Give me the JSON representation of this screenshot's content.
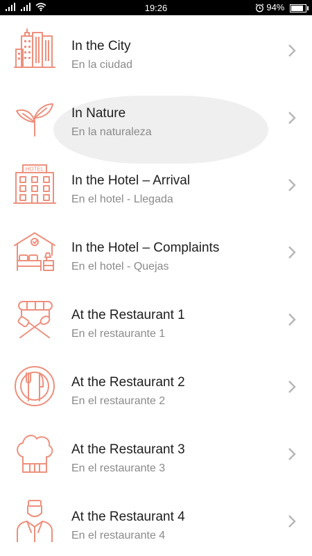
{
  "status_bar": {
    "time": "19:26",
    "battery": "94%",
    "battery_level": 0.94
  },
  "theme": {
    "icon_color": "#ee8f7c",
    "title_color": "#1d1d1d",
    "subtitle_color": "#8a8a8a"
  },
  "items": [
    {
      "title": "In the City",
      "subtitle": "En la ciudad",
      "icon": "city-buildings-icon"
    },
    {
      "title": "In Nature",
      "subtitle": "En la naturaleza",
      "icon": "sprout-icon"
    },
    {
      "title": "In the Hotel – Arrival",
      "subtitle": "En el hotel - Llegada",
      "icon": "hotel-building-icon",
      "icon_text": "HOTEL"
    },
    {
      "title": "In the Hotel – Complaints",
      "subtitle": "En el hotel - Quejas",
      "icon": "hotel-room-bed-icon"
    },
    {
      "title": "At the Restaurant 1",
      "subtitle": "En el restaurante 1",
      "icon": "grill-utensils-icon"
    },
    {
      "title": "At the Restaurant 2",
      "subtitle": "En el restaurante 2",
      "icon": "plate-fork-knife-icon"
    },
    {
      "title": "At the Restaurant 3",
      "subtitle": "En el restaurante 3",
      "icon": "chef-hat-icon"
    },
    {
      "title": "At the Restaurant 4",
      "subtitle": "En el restaurante 4",
      "icon": "waiter-icon"
    }
  ]
}
